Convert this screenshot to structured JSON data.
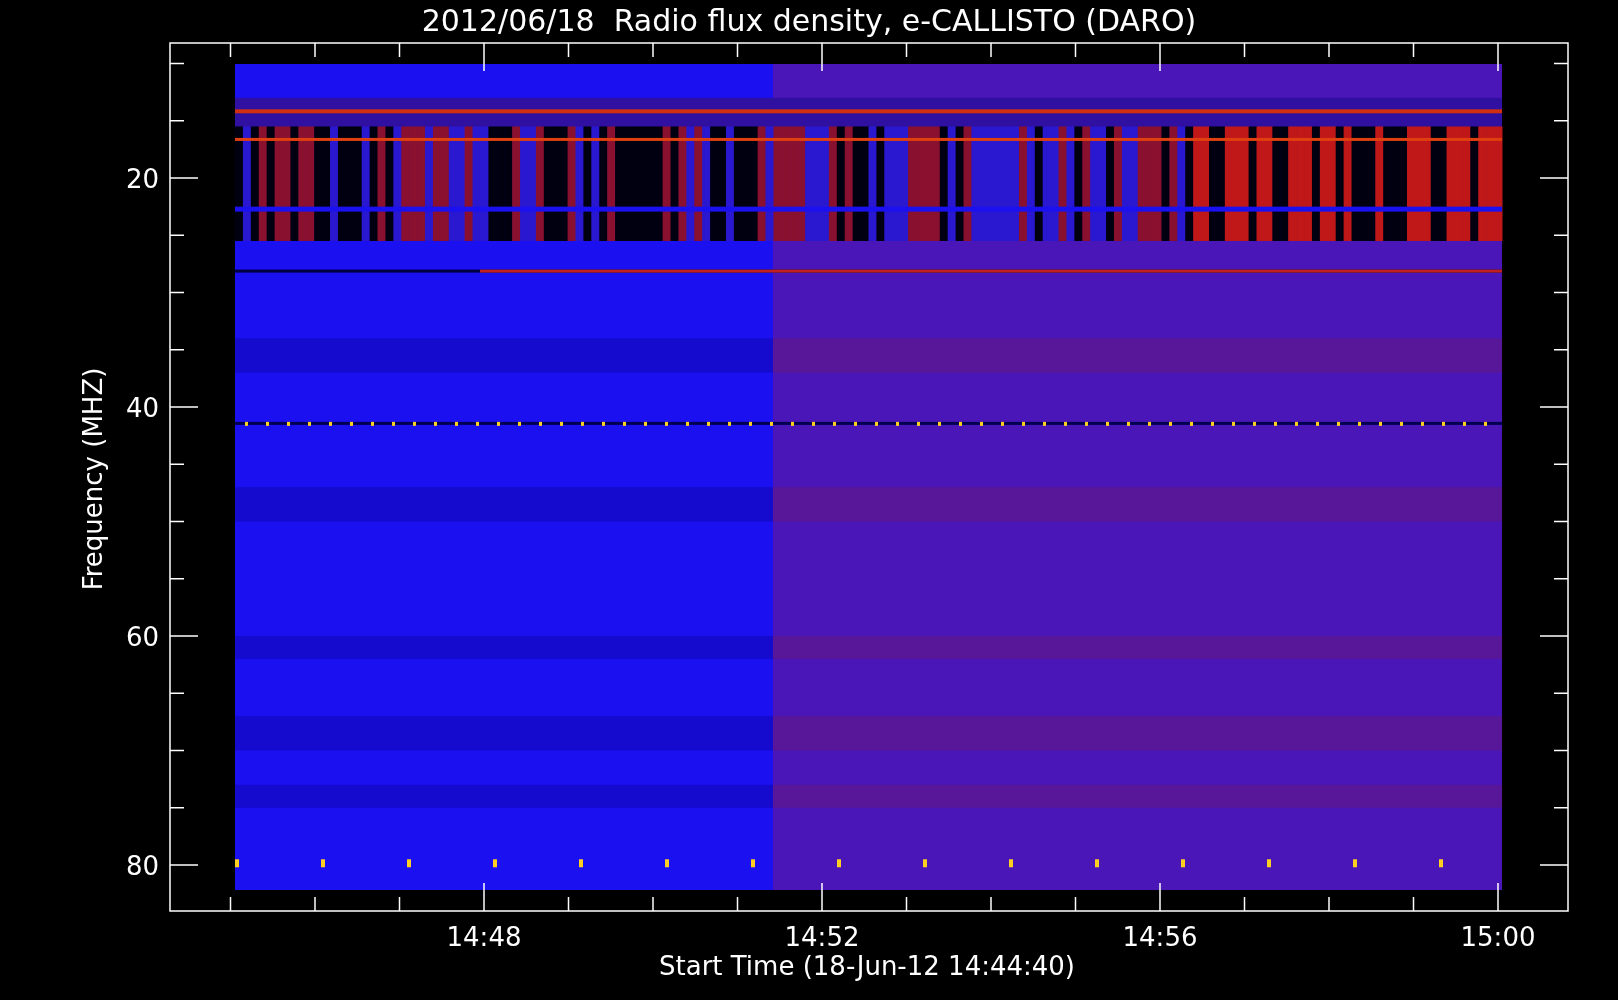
{
  "title": "2012/06/18  Radio flux density, e-CALLISTO (DARO)",
  "y_axis": {
    "label": "Frequency (MHZ)",
    "ticks": [
      "20",
      "40",
      "60",
      "80"
    ]
  },
  "x_axis": {
    "label": "Start Time (18-Jun-12 14:44:40)",
    "ticks": [
      "14:48",
      "14:52",
      "14:56",
      "15:00"
    ]
  }
}
